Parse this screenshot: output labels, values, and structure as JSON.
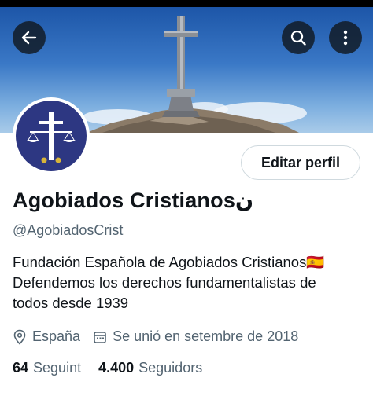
{
  "header": {
    "back_icon": "arrow-left-icon",
    "search_icon": "search-icon",
    "more_icon": "more-vertical-icon"
  },
  "profile": {
    "display_name": "Agobiados Cristianosن",
    "handle": "@AgobiadosCrist",
    "edit_button_label": "Editar perfil",
    "bio_lines": [
      "Fundación Española de Agobiados Cristianos🇪🇸",
      "Defendemos los derechos fundamentalistas de",
      "todos desde 1939"
    ],
    "location": "España",
    "joined": "Se unió en setembre de 2018",
    "following_count": "64",
    "following_label": "Seguint",
    "followers_count": "4.400",
    "followers_label": "Seguidors"
  },
  "colors": {
    "avatar_bg": "#2d3782",
    "text_primary": "#0f1419",
    "text_secondary": "#536471",
    "border": "#cfd9de"
  }
}
